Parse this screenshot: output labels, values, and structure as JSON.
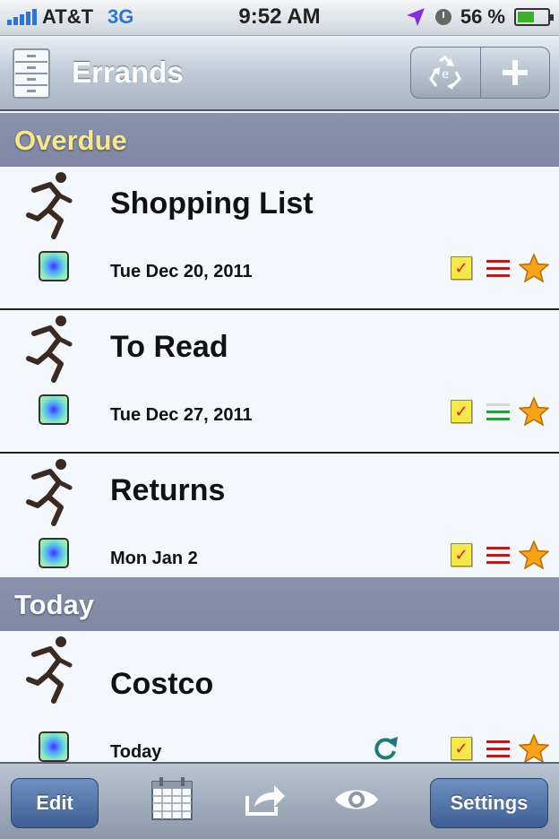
{
  "status_bar": {
    "carrier": "AT&T",
    "network": "3G",
    "time": "9:52 AM",
    "battery_percent": "56 %",
    "battery_level": 0.56,
    "signal_bars": 5,
    "icons": [
      "signal-bars-icon",
      "location-arrow-icon",
      "alarm-clock-icon",
      "battery-icon"
    ]
  },
  "nav": {
    "title": "Errands",
    "icons": [
      "file-cabinet-icon",
      "recycle-icon",
      "plus-icon"
    ]
  },
  "sections": [
    {
      "title": "Overdue"
    },
    {
      "title": "Today"
    }
  ],
  "rows": [
    {
      "title": "Shopping List",
      "date": "Tue Dec 20, 2011",
      "priority_color": "#b02020",
      "repeat": false
    },
    {
      "title": "To Read",
      "date": "Tue Dec 27, 2011",
      "priority_color": "#2a9a3a",
      "repeat": false
    },
    {
      "title": "Returns",
      "date": "Mon Jan 2",
      "priority_color": "#b02020",
      "repeat": false
    },
    {
      "title": "Costco",
      "date": "Today",
      "priority_color": "#b02020",
      "repeat": true
    }
  ],
  "row_icons": [
    "runner-icon",
    "color-swatch-icon",
    "checkbox-checked-icon",
    "priority-lines-icon",
    "star-icon",
    "repeat-arrow-icon"
  ],
  "toolbar": {
    "edit_label": "Edit",
    "settings_label": "Settings",
    "icons": [
      "calendar-icon",
      "share-icon",
      "eye-icon"
    ]
  },
  "colors": {
    "overdue_header_text": "#f9e88a",
    "section_header_bg": "#8a92ad",
    "star": "#f6a21b",
    "repeat_arrow": "#1f7a7a",
    "toolbar_button": "#4b6da3"
  }
}
